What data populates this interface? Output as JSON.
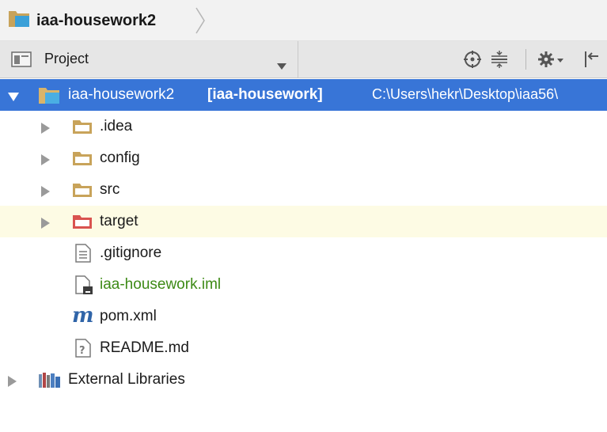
{
  "breadcrumb": {
    "project_name": "iaa-housework2"
  },
  "tool_window": {
    "view_mode": "Project",
    "buttons": [
      "locate-icon",
      "collapse-all-icon",
      "settings-icon",
      "hide-icon"
    ]
  },
  "tree": {
    "root": {
      "name": "iaa-housework2",
      "module": "[iaa-housework]",
      "path": "C:\\Users\\hekr\\Desktop\\iaa56\\"
    },
    "items": [
      {
        "label": ".idea",
        "type": "folder"
      },
      {
        "label": "config",
        "type": "folder"
      },
      {
        "label": "src",
        "type": "folder"
      },
      {
        "label": "target",
        "type": "excluded-folder"
      },
      {
        "label": ".gitignore",
        "type": "text-file"
      },
      {
        "label": "iaa-housework.iml",
        "type": "module-file"
      },
      {
        "label": "pom.xml",
        "type": "maven-file"
      },
      {
        "label": "README.md",
        "type": "unknown-file"
      }
    ],
    "external": {
      "label": "External Libraries"
    }
  },
  "colors": {
    "selection": "#3875d7",
    "highlight_row": "#fdfbe4",
    "iml_text": "#3d8a16",
    "folder": "#c8a35a",
    "excluded_folder": "#d9534f"
  }
}
